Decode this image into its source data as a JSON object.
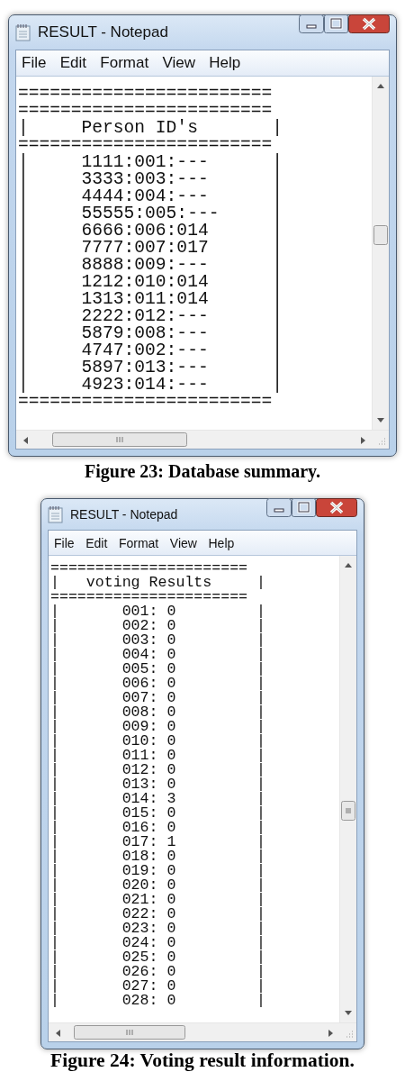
{
  "figures": [
    {
      "window": {
        "title": "RESULT - Notepad",
        "menu": [
          "File",
          "Edit",
          "Format",
          "View",
          "Help"
        ],
        "lines": [
          "========================",
          "========================",
          "|     Person ID's       |",
          "========================",
          "|     1111:001:---      |",
          "|     3333:003:---      |",
          "|     4444:004:---      |",
          "|     55555:005:---     |",
          "|     6666:006:014      |",
          "|     7777:007:017      |",
          "|     8888:009:---      |",
          "|     1212:010:014      |",
          "|     1313:011:014      |",
          "|     2222:012:---      |",
          "|     5879:008:---      |",
          "|     4747:002:---      |",
          "|     5897:013:---      |",
          "|     4923:014:---      |",
          "========================"
        ]
      },
      "caption": "Figure 23: Database summary."
    },
    {
      "window": {
        "title": "RESULT - Notepad",
        "menu": [
          "File",
          "Edit",
          "Format",
          "View",
          "Help"
        ],
        "lines": [
          "======================",
          "|   voting Results     |",
          "======================",
          "|       001: 0         |",
          "|       002: 0         |",
          "|       003: 0         |",
          "|       004: 0         |",
          "|       005: 0         |",
          "|       006: 0         |",
          "|       007: 0         |",
          "|       008: 0         |",
          "|       009: 0         |",
          "|       010: 0         |",
          "|       011: 0         |",
          "|       012: 0         |",
          "|       013: 0         |",
          "|       014: 3         |",
          "|       015: 0         |",
          "|       016: 0         |",
          "|       017: 1         |",
          "|       018: 0         |",
          "|       019: 0         |",
          "|       020: 0         |",
          "|       021: 0         |",
          "|       022: 0         |",
          "|       023: 0         |",
          "|       024: 0         |",
          "|       025: 0         |",
          "|       026: 0         |",
          "|       027: 0         |",
          "|       028: 0         |"
        ]
      },
      "caption": "Figure 24: Voting result information."
    }
  ]
}
